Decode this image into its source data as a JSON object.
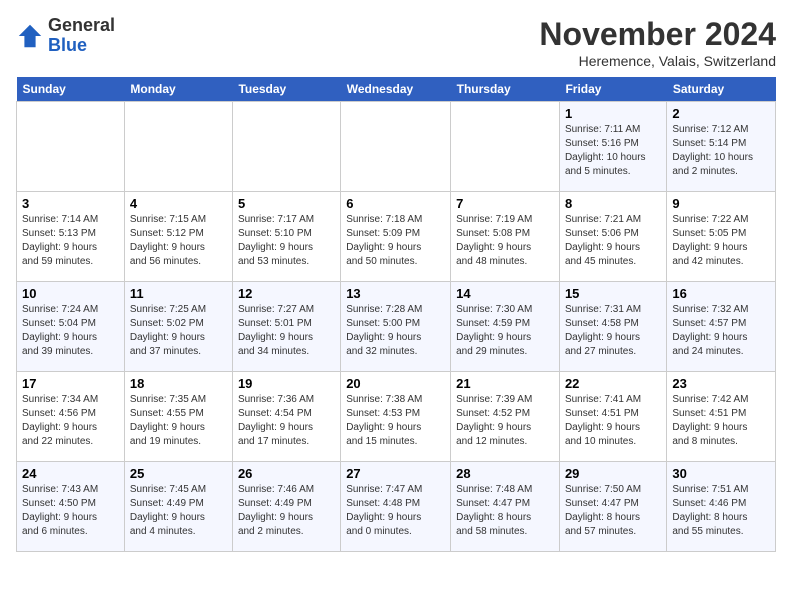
{
  "logo": {
    "general": "General",
    "blue": "Blue"
  },
  "header": {
    "month": "November 2024",
    "location": "Heremence, Valais, Switzerland"
  },
  "days_of_week": [
    "Sunday",
    "Monday",
    "Tuesday",
    "Wednesday",
    "Thursday",
    "Friday",
    "Saturday"
  ],
  "weeks": [
    [
      {
        "day": "",
        "info": ""
      },
      {
        "day": "",
        "info": ""
      },
      {
        "day": "",
        "info": ""
      },
      {
        "day": "",
        "info": ""
      },
      {
        "day": "",
        "info": ""
      },
      {
        "day": "1",
        "info": "Sunrise: 7:11 AM\nSunset: 5:16 PM\nDaylight: 10 hours\nand 5 minutes."
      },
      {
        "day": "2",
        "info": "Sunrise: 7:12 AM\nSunset: 5:14 PM\nDaylight: 10 hours\nand 2 minutes."
      }
    ],
    [
      {
        "day": "3",
        "info": "Sunrise: 7:14 AM\nSunset: 5:13 PM\nDaylight: 9 hours\nand 59 minutes."
      },
      {
        "day": "4",
        "info": "Sunrise: 7:15 AM\nSunset: 5:12 PM\nDaylight: 9 hours\nand 56 minutes."
      },
      {
        "day": "5",
        "info": "Sunrise: 7:17 AM\nSunset: 5:10 PM\nDaylight: 9 hours\nand 53 minutes."
      },
      {
        "day": "6",
        "info": "Sunrise: 7:18 AM\nSunset: 5:09 PM\nDaylight: 9 hours\nand 50 minutes."
      },
      {
        "day": "7",
        "info": "Sunrise: 7:19 AM\nSunset: 5:08 PM\nDaylight: 9 hours\nand 48 minutes."
      },
      {
        "day": "8",
        "info": "Sunrise: 7:21 AM\nSunset: 5:06 PM\nDaylight: 9 hours\nand 45 minutes."
      },
      {
        "day": "9",
        "info": "Sunrise: 7:22 AM\nSunset: 5:05 PM\nDaylight: 9 hours\nand 42 minutes."
      }
    ],
    [
      {
        "day": "10",
        "info": "Sunrise: 7:24 AM\nSunset: 5:04 PM\nDaylight: 9 hours\nand 39 minutes."
      },
      {
        "day": "11",
        "info": "Sunrise: 7:25 AM\nSunset: 5:02 PM\nDaylight: 9 hours\nand 37 minutes."
      },
      {
        "day": "12",
        "info": "Sunrise: 7:27 AM\nSunset: 5:01 PM\nDaylight: 9 hours\nand 34 minutes."
      },
      {
        "day": "13",
        "info": "Sunrise: 7:28 AM\nSunset: 5:00 PM\nDaylight: 9 hours\nand 32 minutes."
      },
      {
        "day": "14",
        "info": "Sunrise: 7:30 AM\nSunset: 4:59 PM\nDaylight: 9 hours\nand 29 minutes."
      },
      {
        "day": "15",
        "info": "Sunrise: 7:31 AM\nSunset: 4:58 PM\nDaylight: 9 hours\nand 27 minutes."
      },
      {
        "day": "16",
        "info": "Sunrise: 7:32 AM\nSunset: 4:57 PM\nDaylight: 9 hours\nand 24 minutes."
      }
    ],
    [
      {
        "day": "17",
        "info": "Sunrise: 7:34 AM\nSunset: 4:56 PM\nDaylight: 9 hours\nand 22 minutes."
      },
      {
        "day": "18",
        "info": "Sunrise: 7:35 AM\nSunset: 4:55 PM\nDaylight: 9 hours\nand 19 minutes."
      },
      {
        "day": "19",
        "info": "Sunrise: 7:36 AM\nSunset: 4:54 PM\nDaylight: 9 hours\nand 17 minutes."
      },
      {
        "day": "20",
        "info": "Sunrise: 7:38 AM\nSunset: 4:53 PM\nDaylight: 9 hours\nand 15 minutes."
      },
      {
        "day": "21",
        "info": "Sunrise: 7:39 AM\nSunset: 4:52 PM\nDaylight: 9 hours\nand 12 minutes."
      },
      {
        "day": "22",
        "info": "Sunrise: 7:41 AM\nSunset: 4:51 PM\nDaylight: 9 hours\nand 10 minutes."
      },
      {
        "day": "23",
        "info": "Sunrise: 7:42 AM\nSunset: 4:51 PM\nDaylight: 9 hours\nand 8 minutes."
      }
    ],
    [
      {
        "day": "24",
        "info": "Sunrise: 7:43 AM\nSunset: 4:50 PM\nDaylight: 9 hours\nand 6 minutes."
      },
      {
        "day": "25",
        "info": "Sunrise: 7:45 AM\nSunset: 4:49 PM\nDaylight: 9 hours\nand 4 minutes."
      },
      {
        "day": "26",
        "info": "Sunrise: 7:46 AM\nSunset: 4:49 PM\nDaylight: 9 hours\nand 2 minutes."
      },
      {
        "day": "27",
        "info": "Sunrise: 7:47 AM\nSunset: 4:48 PM\nDaylight: 9 hours\nand 0 minutes."
      },
      {
        "day": "28",
        "info": "Sunrise: 7:48 AM\nSunset: 4:47 PM\nDaylight: 8 hours\nand 58 minutes."
      },
      {
        "day": "29",
        "info": "Sunrise: 7:50 AM\nSunset: 4:47 PM\nDaylight: 8 hours\nand 57 minutes."
      },
      {
        "day": "30",
        "info": "Sunrise: 7:51 AM\nSunset: 4:46 PM\nDaylight: 8 hours\nand 55 minutes."
      }
    ]
  ]
}
